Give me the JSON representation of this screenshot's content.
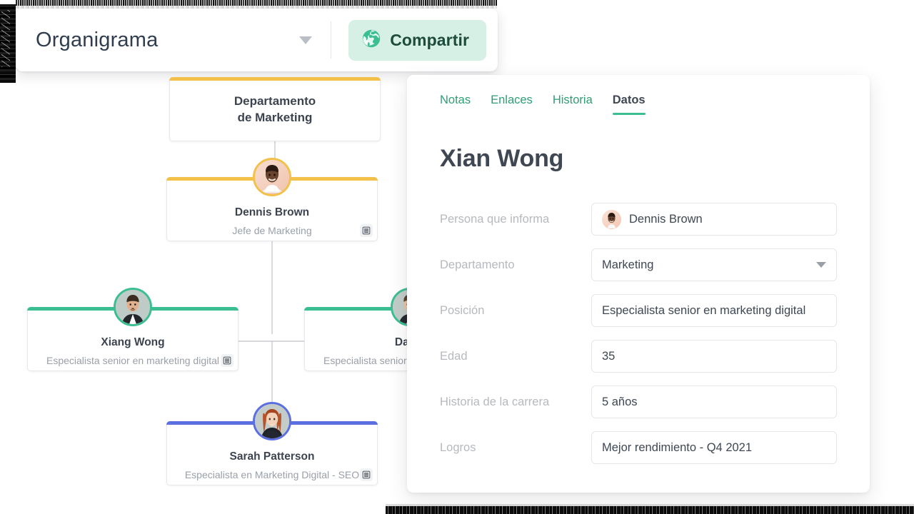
{
  "toolbar": {
    "document_title": "Organigrama",
    "title_caret_icon": "chevron-down-icon",
    "share_label": "Compartir",
    "share_icon": "globe-icon",
    "share_bg": "#d7f0e5",
    "share_text_color": "#1d4b3c"
  },
  "chart": {
    "nodes": [
      {
        "id": "dept",
        "name_line1": "Departamento",
        "name_line2": "de Marketing",
        "role": "",
        "accent": "#f3c04a",
        "has_avatar": false,
        "has_db_icon": false
      },
      {
        "id": "dennis",
        "name": "Dennis Brown",
        "role": "Jefe de Marketing",
        "accent": "#f3c04a",
        "avatar_ring": "#f3c04a",
        "has_avatar": true,
        "has_db_icon": true,
        "db_icon": "database-icon"
      },
      {
        "id": "xiang",
        "name": "Xiang Wong",
        "role": "Especialista senior en marketing digital",
        "accent": "#3bbf92",
        "avatar_ring": "#3bbf92",
        "has_avatar": true,
        "has_db_icon": true,
        "db_icon": "database-icon"
      },
      {
        "id": "david",
        "name": "David",
        "role": "Especialista senior en marketing digital",
        "accent": "#3bbf92",
        "avatar_ring": "#3bbf92",
        "has_avatar": true,
        "has_db_icon": false
      },
      {
        "id": "sarah",
        "name": "Sarah Patterson",
        "role": "Especialista en Marketing Digital - SEO",
        "accent": "#5b6fe0",
        "avatar_ring": "#5b6fe0",
        "has_avatar": true,
        "has_db_icon": true,
        "db_icon": "database-icon"
      }
    ]
  },
  "panel": {
    "tabs": [
      {
        "label": "Notas",
        "active": false
      },
      {
        "label": "Enlaces",
        "active": false
      },
      {
        "label": "Historia",
        "active": false
      },
      {
        "label": "Datos",
        "active": true
      }
    ],
    "person_name": "Xian Wong",
    "accent_color": "#3bbf92",
    "fields": [
      {
        "label": "Persona que informa",
        "value": "Dennis Brown",
        "type": "person",
        "avatar_icon": "avatar-icon"
      },
      {
        "label": "Departamento",
        "value": "Marketing",
        "type": "select",
        "caret_icon": "chevron-down-icon"
      },
      {
        "label": "Posición",
        "value": "Especialista senior en marketing digital",
        "type": "text"
      },
      {
        "label": "Edad",
        "value": "35",
        "type": "text"
      },
      {
        "label": "Historia de la carrera",
        "value": "5 años",
        "type": "text"
      },
      {
        "label": "Logros",
        "value": "Mejor rendimiento - Q4 2021",
        "type": "text"
      }
    ]
  }
}
